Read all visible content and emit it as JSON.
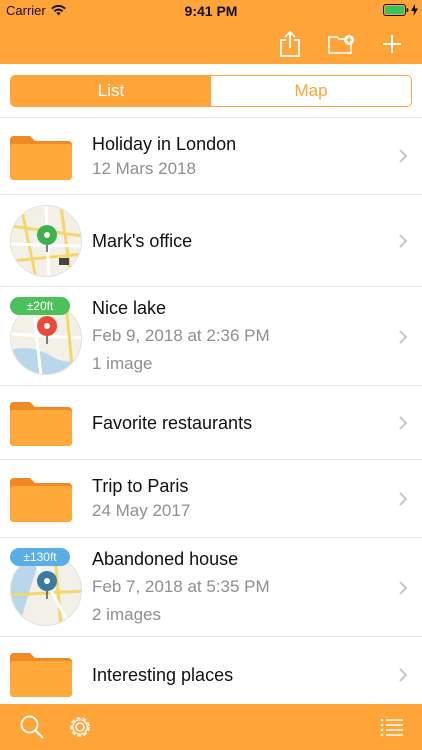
{
  "status": {
    "carrier": "Carrier",
    "time": "9:41 PM"
  },
  "segments": {
    "list": "List",
    "map": "Map",
    "selected": "List"
  },
  "items": [
    {
      "type": "folder",
      "title": "Holiday in London",
      "subtitle": "12 Mars 2018"
    },
    {
      "type": "place",
      "title": "Mark's office",
      "pin_color": "#3eb24a"
    },
    {
      "type": "place",
      "title": "Nice lake",
      "subtitle": "Feb 9, 2018 at 2:36 PM",
      "detail": "1 image",
      "badge": "±20ft",
      "badge_color": "#4cc05a",
      "pin_color": "#e84b3c"
    },
    {
      "type": "folder",
      "title": "Favorite restaurants"
    },
    {
      "type": "folder",
      "title": "Trip to Paris",
      "subtitle": "24 May 2017"
    },
    {
      "type": "place",
      "title": "Abandoned house",
      "subtitle": "Feb 7, 2018 at 5:35 PM",
      "detail": "2 images",
      "badge": "±130ft",
      "badge_color": "#5aaee6",
      "pin_color": "#3c7aa0"
    },
    {
      "type": "folder",
      "title": "Interesting places"
    }
  ],
  "colors": {
    "accent": "#fea438",
    "folder": "#ffa93b",
    "folder_tab": "#f08a24"
  },
  "icons": {
    "nav": [
      "share-icon",
      "new-folder-icon",
      "add-icon"
    ],
    "bottom": [
      "search-icon",
      "settings-icon",
      "list-icon"
    ]
  }
}
